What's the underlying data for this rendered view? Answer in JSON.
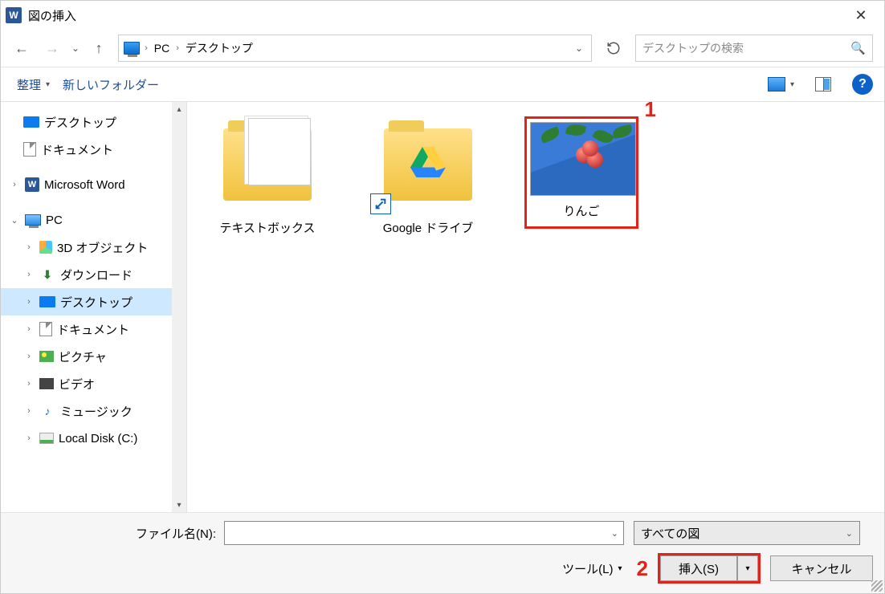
{
  "title": "図の挿入",
  "path": {
    "root": "PC",
    "current": "デスクトップ"
  },
  "search": {
    "placeholder": "デスクトップの検索"
  },
  "toolbar": {
    "organize": "整理",
    "new_folder": "新しいフォルダー"
  },
  "quick": {
    "desktop": "デスクトップ",
    "documents": "ドキュメント",
    "word": "Microsoft Word"
  },
  "pc": {
    "label": "PC",
    "obj3d": "3D オブジェクト",
    "downloads": "ダウンロード",
    "desktop": "デスクトップ",
    "documents": "ドキュメント",
    "pictures": "ピクチャ",
    "videos": "ビデオ",
    "music": "ミュージック",
    "disk": "Local Disk (C:)"
  },
  "files": {
    "textbox": "テキストボックス",
    "gdrive": "Google ドライブ",
    "apple": "りんご"
  },
  "footer": {
    "filename_label": "ファイル名(N):",
    "filter": "すべての図",
    "tools": "ツール(L)",
    "insert": "挿入(S)",
    "cancel": "キャンセル"
  },
  "annotations": {
    "one": "1",
    "two": "2"
  }
}
